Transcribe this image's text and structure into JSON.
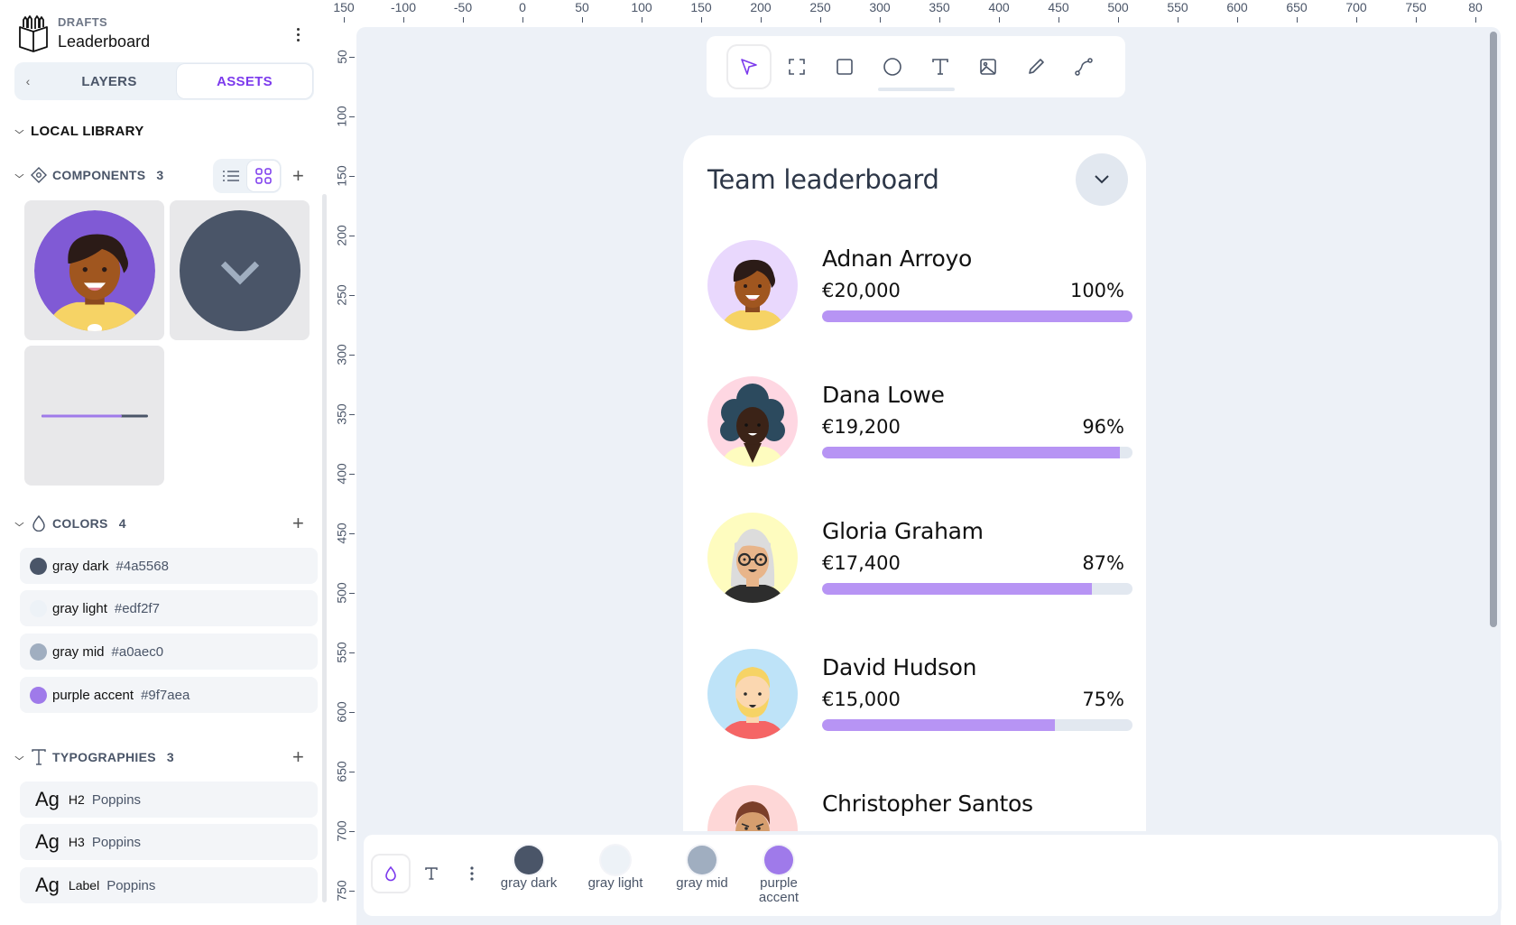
{
  "project": {
    "section_label": "DRAFTS",
    "file_name": "Leaderboard"
  },
  "sidebar": {
    "tabs": [
      {
        "label": "LAYERS",
        "active": false
      },
      {
        "label": "ASSETS",
        "active": true
      }
    ],
    "library_title": "LOCAL LIBRARY",
    "components": {
      "title": "COMPONENTS",
      "count": "3",
      "view_mode": "grid",
      "items": [
        {
          "name": "avatar-component"
        },
        {
          "name": "dropdown-button-component"
        },
        {
          "name": "progress-bar-component"
        }
      ]
    },
    "colors": {
      "title": "COLORS",
      "count": "4",
      "items": [
        {
          "name": "gray dark",
          "hex": "#4a5568"
        },
        {
          "name": "gray light",
          "hex": "#edf2f7"
        },
        {
          "name": "gray mid",
          "hex": "#a0aec0"
        },
        {
          "name": "purple accent",
          "hex": "#9f7aea"
        }
      ]
    },
    "typographies": {
      "title": "TYPOGRAPHIES",
      "count": "3",
      "items": [
        {
          "sample": "Ag",
          "name": "H2",
          "font": "Poppins"
        },
        {
          "sample": "Ag",
          "name": "H3",
          "font": "Poppins"
        },
        {
          "sample": "Ag",
          "name": "Label",
          "font": "Poppins"
        }
      ]
    }
  },
  "rulers": {
    "horizontal": [
      "150",
      "-100",
      "-50",
      "0",
      "50",
      "100",
      "150",
      "200",
      "250",
      "300",
      "350",
      "400",
      "450",
      "500",
      "550",
      "600",
      "650",
      "700",
      "750",
      "80"
    ],
    "vertical": [
      "50",
      "100",
      "150",
      "200",
      "250",
      "300",
      "350",
      "400",
      "450",
      "500",
      "550",
      "600",
      "650",
      "700",
      "750"
    ]
  },
  "toolbar": {
    "tools": [
      {
        "name": "move-tool",
        "icon": "pointer-icon",
        "active": true
      },
      {
        "name": "board-tool",
        "icon": "frame-icon",
        "active": false
      },
      {
        "name": "rectangle-tool",
        "icon": "rectangle-icon",
        "active": false
      },
      {
        "name": "ellipse-tool",
        "icon": "ellipse-icon",
        "active": false
      },
      {
        "name": "text-tool",
        "icon": "text-icon",
        "active": false
      },
      {
        "name": "image-tool",
        "icon": "image-icon",
        "active": false
      },
      {
        "name": "pencil-tool",
        "icon": "pencil-icon",
        "active": false
      },
      {
        "name": "path-tool",
        "icon": "path-icon",
        "active": false
      }
    ]
  },
  "leaderboard": {
    "title": "Team leaderboard",
    "rows": [
      {
        "name": "Adnan Arroyo",
        "amount": "€20,000",
        "percent_label": "100%",
        "progress": 100,
        "avatar_bg": "#e9d8fd"
      },
      {
        "name": "Dana Lowe",
        "amount": "€19,200",
        "percent_label": "96%",
        "progress": 96,
        "avatar_bg": "#fed7e2"
      },
      {
        "name": "Gloria Graham",
        "amount": "€17,400",
        "percent_label": "87%",
        "progress": 87,
        "avatar_bg": "#fefcbf"
      },
      {
        "name": "David Hudson",
        "amount": "€15,000",
        "percent_label": "75%",
        "progress": 75,
        "avatar_bg": "#bee3f8"
      },
      {
        "name": "Christopher Santos",
        "amount": "",
        "percent_label": "",
        "progress": null,
        "avatar_bg": "#fed7d7"
      }
    ]
  },
  "palette_bar": {
    "modes": [
      {
        "name": "colors-mode",
        "icon": "drop-icon",
        "active": true
      },
      {
        "name": "typography-mode",
        "icon": "text-icon",
        "active": false
      }
    ],
    "swatches": [
      {
        "label": "gray dark",
        "hex": "#4a5568"
      },
      {
        "label": "gray light",
        "hex": "#edf2f7"
      },
      {
        "label": "gray mid",
        "hex": "#a0aec0"
      },
      {
        "label": "purple accent",
        "hex": "#9f7aea"
      }
    ]
  },
  "theme": {
    "accent": "#7c3aed",
    "canvas_bg": "#edf1f7",
    "progress_fill": "#b794f4",
    "progress_track": "#e2e8f0"
  }
}
